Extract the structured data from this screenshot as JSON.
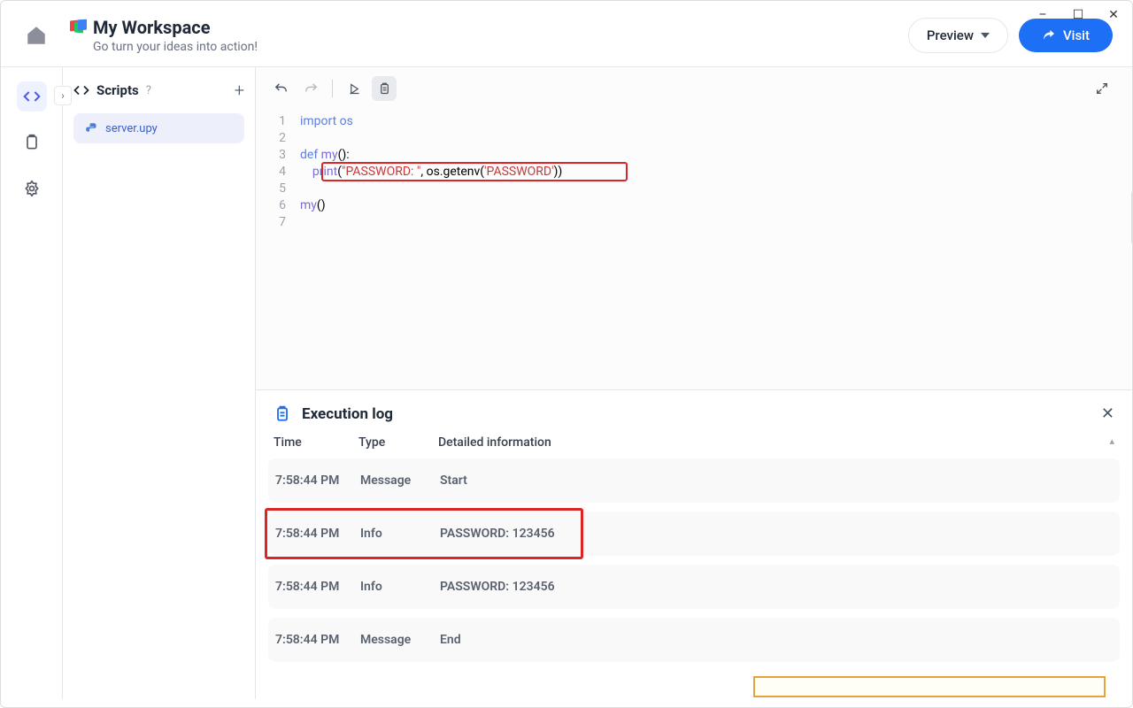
{
  "window": {
    "min": "–",
    "max": "☐",
    "close": "✕"
  },
  "header": {
    "title": "My Workspace",
    "subtitle": "Go turn your ideas into action!",
    "preview_label": "Preview",
    "visit_label": "Visit"
  },
  "sidebar": {
    "panel_title": "Scripts",
    "file_name": "server.upy"
  },
  "code": {
    "lines": {
      "l1": "import os",
      "l2": "",
      "l3a": "def ",
      "l3b": "my",
      "l3c": "():",
      "l4a": "    ",
      "l4b": "print",
      "l4c": "(",
      "l4d": "\"PASSWORD: \"",
      "l4e": ", os.getenv(",
      "l4f": "'PASSWORD'",
      "l4g": "))",
      "l5": "",
      "l6a": "my",
      "l6b": "()",
      "l7": ""
    },
    "gutter": [
      "1",
      "2",
      "3",
      "4",
      "5",
      "6",
      "7"
    ]
  },
  "exec": {
    "title": "Execution log",
    "cols": {
      "time": "Time",
      "type": "Type",
      "info": "Detailed information"
    },
    "rows": [
      {
        "time": "7:58:44 PM",
        "type": "Message",
        "info": "Start"
      },
      {
        "time": "7:58:44 PM",
        "type": "Info",
        "info": "PASSWORD: 123456"
      },
      {
        "time": "7:58:44 PM",
        "type": "Info",
        "info": "PASSWORD: 123456"
      },
      {
        "time": "7:58:44 PM",
        "type": "Message",
        "info": "End"
      }
    ]
  }
}
